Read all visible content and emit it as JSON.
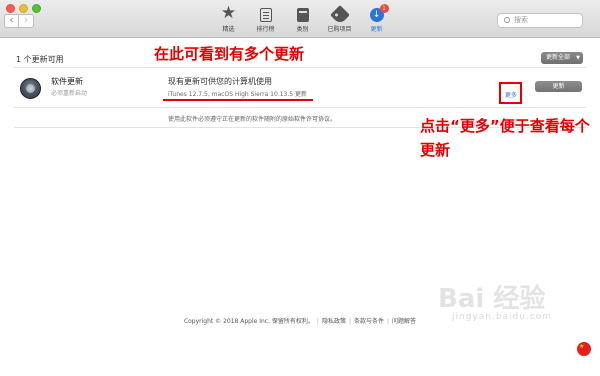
{
  "window": {
    "toolbar": [
      {
        "label": "精选",
        "icon": "star-icon"
      },
      {
        "label": "排行榜",
        "icon": "list-icon"
      },
      {
        "label": "类别",
        "icon": "box-icon"
      },
      {
        "label": "已购项目",
        "icon": "tag-icon"
      },
      {
        "label": "更新",
        "icon": "updates-icon",
        "badge": "1",
        "active": true
      }
    ],
    "search_placeholder": "搜索"
  },
  "updates": {
    "count_label": "1 个更新可用",
    "update_all_label": "更新全部",
    "item": {
      "title": "软件更新",
      "subtitle": "必须重新启动",
      "description": "现有更新可供您的计算机使用",
      "versions": "iTunes 12.7.5, macOS High Sierra 10.13.5 更新",
      "more_label": "更多",
      "update_label": "更新"
    },
    "agreement_prefix": "使用此软件必须遵守正在更新的软件随附的原始",
    "agreement_link": "软件许可协议",
    "agreement_suffix": "。"
  },
  "annotations": {
    "top_note": "在此可看到有多个更新",
    "more_note": "点击“更多”便于查看每个更新"
  },
  "footer": {
    "copyright": "Copyright © 2018 Apple Inc. 保留所有权利。",
    "links": [
      "隐私政策",
      "条款与条件",
      "问题解答"
    ]
  },
  "watermark": {
    "logo": "Bai 经验",
    "url": "jingyan.baidu.com"
  },
  "colors": {
    "accent": "#2a74d9",
    "annotation_red": "#e50000",
    "badge_red": "#f4443d"
  }
}
